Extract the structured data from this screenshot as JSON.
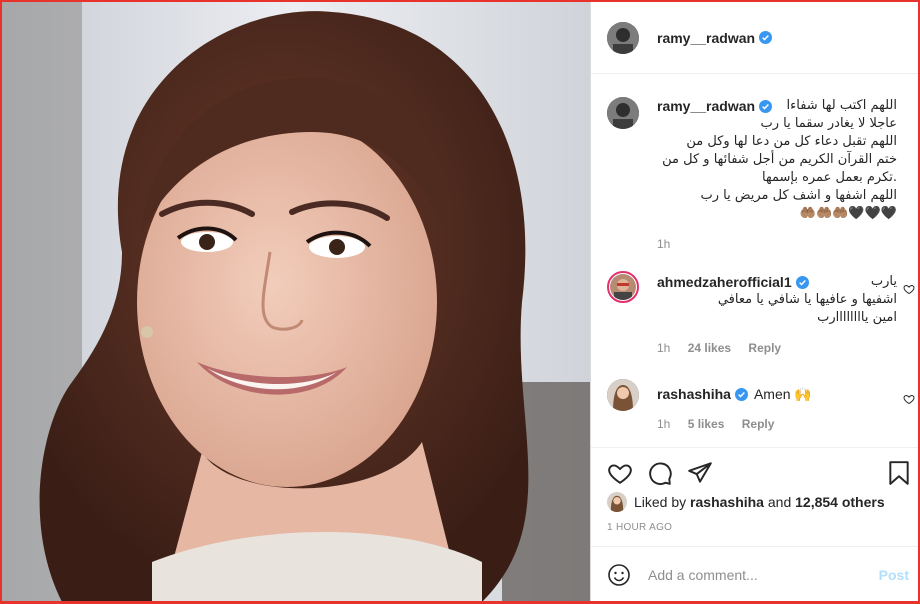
{
  "post": {
    "author": "ramy__radwan",
    "caption_lines": [
      "اللهم اكتب لها شفاءا",
      "عاجلا لا يغادر سقما يا رب",
      "اللهم تقبل دعاء كل من دعا لها وكل من",
      "ختم القرآن الكريم من أجل شفائها و كل من",
      ".تكرم بعمل عمره بإسمها",
      "اللهم اشفها و اشف كل مريض يا رب",
      "🖤🖤🖤🤲🏽🤲🏽🤲🏽"
    ],
    "caption_time": "1h",
    "accent_color": "#3897f0",
    "frame_color": "#e8332c"
  },
  "comments": [
    {
      "user": "ahmedzaherofficial1",
      "lines": [
        "يارب",
        "اشفيها و عافيها يا شافي يا معافي",
        "امين ياااااااارب"
      ],
      "time": "1h",
      "likes": "24 likes",
      "reply": "Reply"
    },
    {
      "user": "rashashiha",
      "text": "Amen 🙌",
      "time": "1h",
      "likes": "5 likes",
      "reply": "Reply"
    }
  ],
  "engagement": {
    "liked_by_prefix": "Liked by",
    "liked_by_user": "rashashiha",
    "and": "and",
    "others": "12,854 others",
    "timestamp": "1 HOUR AGO"
  },
  "composer": {
    "placeholder": "Add a comment...",
    "post_label": "Post"
  },
  "icons": {
    "like": "heart-icon",
    "comment": "comment-icon",
    "share": "share-icon",
    "save": "bookmark-icon",
    "emoji": "emoji-icon"
  }
}
